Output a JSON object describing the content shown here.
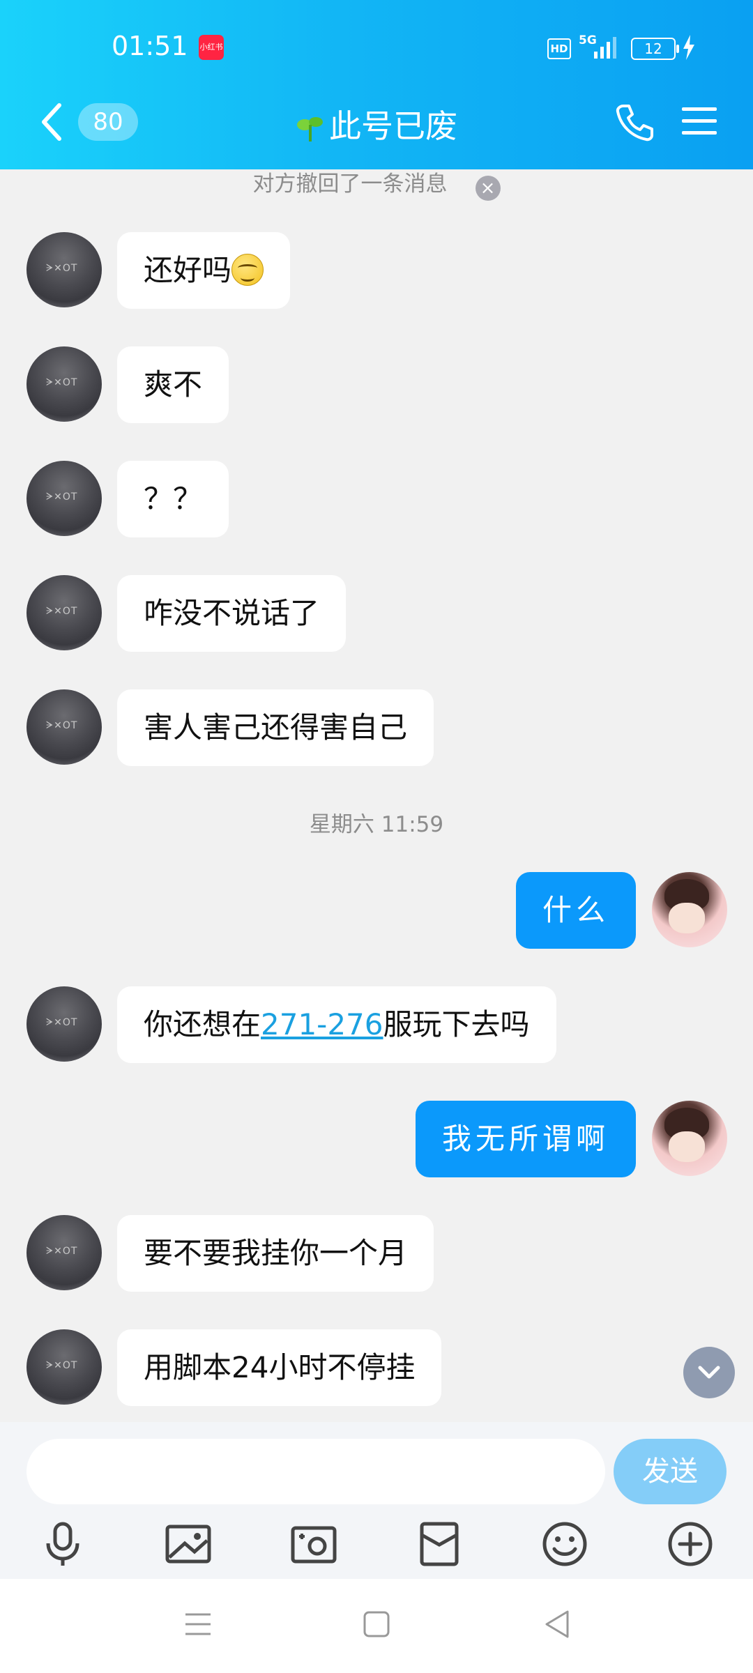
{
  "status_bar": {
    "time": "01:51",
    "app_badge": "小红书",
    "hd": "HD",
    "network": "5G",
    "battery": "12"
  },
  "header": {
    "unread_count": "80",
    "title": "此号已废"
  },
  "recall_notice": "对方撤回了一条消息",
  "timestamp": "星期六 11:59",
  "messages": [
    {
      "side": "left",
      "text": "还好吗"
    },
    {
      "side": "left",
      "text": "爽不"
    },
    {
      "side": "left",
      "text": "？？"
    },
    {
      "side": "left",
      "text": "咋没不说话了"
    },
    {
      "side": "left",
      "text": "害人害己还得害自己"
    },
    {
      "side": "right",
      "text": "什么"
    },
    {
      "side": "left",
      "text_before": "你还想在",
      "link": "271-276",
      "text_after": "服玩下去吗"
    },
    {
      "side": "right",
      "text": "我无所谓啊"
    },
    {
      "side": "left",
      "text": "要不要我挂你一个月"
    },
    {
      "side": "left",
      "text": "用脚本24小时不停挂"
    }
  ],
  "composer": {
    "input_value": "",
    "send_label": "发送"
  },
  "toolbar_icons": [
    "microphone-icon",
    "image-icon",
    "camera-icon",
    "red-envelope-icon",
    "emoji-icon",
    "plus-icon"
  ],
  "colors": {
    "header_accent": "#12b6f5",
    "own_bubble": "#0b99fb",
    "link": "#1aa0e0",
    "send_button": "#84cdf8"
  }
}
